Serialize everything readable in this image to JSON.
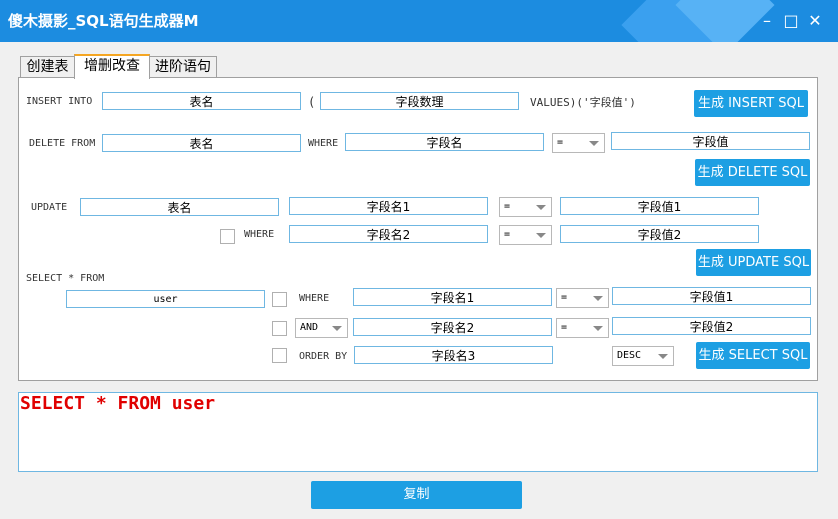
{
  "window": {
    "title": "傻木摄影_SQL语句生成器M"
  },
  "tabs": [
    {
      "label": "创建表"
    },
    {
      "label": "增删改查"
    },
    {
      "label": "进阶语句"
    }
  ],
  "insert": {
    "label1": "INSERT INTO",
    "table": "表名",
    "paren_open": "(",
    "fields": "字段数理",
    "values_label": "VALUES)('字段值')",
    "button": "生成 INSERT SQL"
  },
  "delete": {
    "label": "DELETE FROM",
    "table": "表名",
    "where_label": "WHERE",
    "field": "字段名",
    "op": "=",
    "value": "字段值",
    "button": "生成 DELETE SQL"
  },
  "update": {
    "label": "UPDATE",
    "table": "表名",
    "field1": "字段名1",
    "op1": "=",
    "value1": "字段值1",
    "where_label": "WHERE",
    "field2": "字段名2",
    "op2": "=",
    "value2": "字段值2",
    "button": "生成 UPDATE SQL"
  },
  "select": {
    "label": "SELECT * FROM",
    "table": "user",
    "where_label": "WHERE",
    "field1": "字段名1",
    "op1": "=",
    "value1": "字段值1",
    "logic": "AND",
    "field2": "字段名2",
    "op2": "=",
    "value2": "字段值2",
    "order_label": "ORDER BY",
    "field3": "字段名3",
    "order": "DESC",
    "button": "生成 SELECT SQL"
  },
  "output": {
    "text": "SELECT * FROM user"
  },
  "copy_button": "复制"
}
